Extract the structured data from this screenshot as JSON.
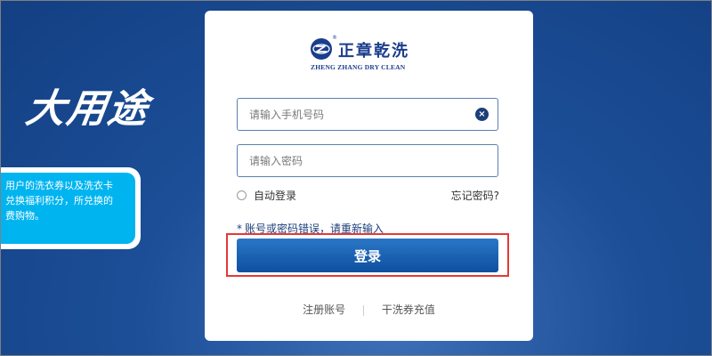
{
  "background": {
    "slogan": "大用途",
    "promo_lines": [
      "用户的洗衣券以及洗衣卡",
      "兑换福利积分，所兑换的",
      "费购物。"
    ]
  },
  "brand": {
    "name_cn": "正章乾洗",
    "name_en": "ZHENG ZHANG DRY CLEAN",
    "registered_mark": "®",
    "logo_icon": "zhengzhang-logo-icon"
  },
  "login_form": {
    "phone_placeholder": "请输入手机号码",
    "phone_value": "",
    "password_placeholder": "请输入密码",
    "password_value": "",
    "clear_icon": "×",
    "remember_label": "自动登录",
    "remember_checked": false,
    "forgot_label": "忘记密码?",
    "error_star": "*",
    "error_message": "账号或密码错误，请重新输入",
    "login_button_label": "登录"
  },
  "footer": {
    "register_label": "注册账号",
    "recharge_label": "干洗券充值"
  },
  "colors": {
    "brand_blue": "#1a3d8c",
    "button_blue": "#1560b0",
    "highlight_red": "#e53935",
    "promo_cyan": "#00b4f0"
  }
}
